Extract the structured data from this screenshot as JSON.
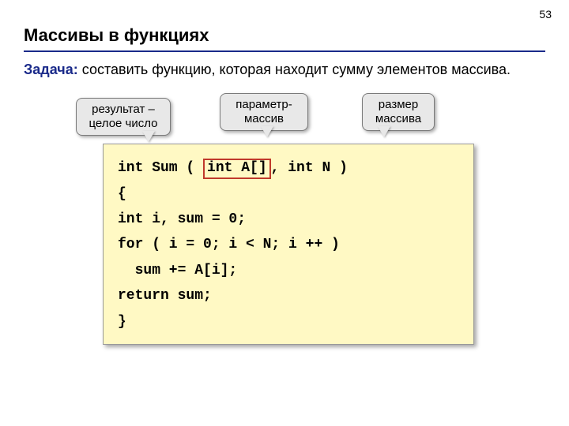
{
  "page_number": "53",
  "title": "Массивы в функциях",
  "task": {
    "label": "Задача:",
    "text": " составить функцию, которая находит сумму элементов массива."
  },
  "callouts": {
    "result": "результат – целое число",
    "param": "параметр-массив",
    "size": "размер массива"
  },
  "code": {
    "l1a": "int Sum ( ",
    "l1_hl": "int A[]",
    "l1b": ", int N )",
    "l2": "{",
    "l3": "int i, sum = 0;",
    "l4": "for ( i = 0; i < N; i ++ )",
    "l5": "  sum += A[i];",
    "l6": "return sum;",
    "l7": "}"
  }
}
